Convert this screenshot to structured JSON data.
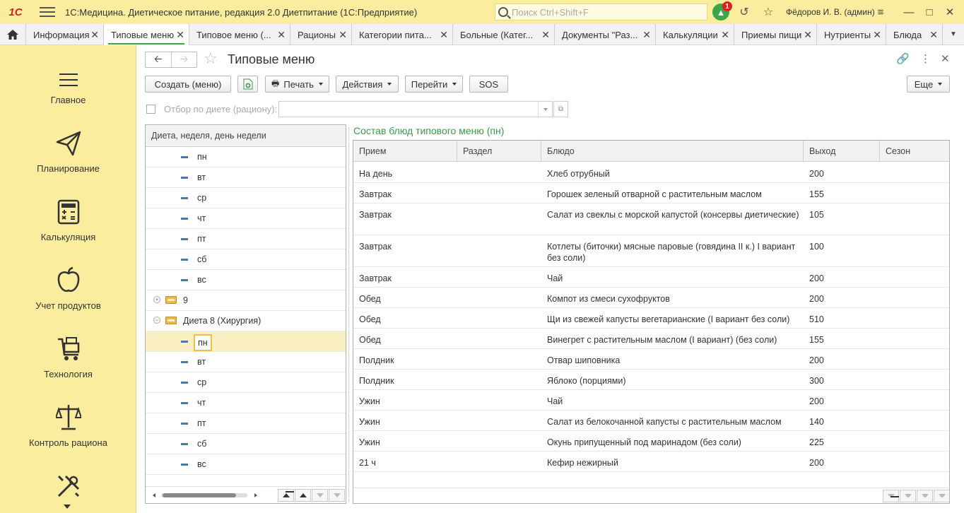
{
  "app": {
    "logo": "1С",
    "title": "1С:Медицина. Диетическое питание, редакция 2.0 Диетпитание  (1С:Предприятие)",
    "search_placeholder": "Поиск Ctrl+Shift+F",
    "notifications": "1",
    "user": "Фёдоров И. В. (админ)"
  },
  "tabs": [
    {
      "label": "Информация"
    },
    {
      "label": "Типовые меню",
      "active": true
    },
    {
      "label": "Типовое меню (..."
    },
    {
      "label": "Рационы"
    },
    {
      "label": "Категории пита..."
    },
    {
      "label": "Больные (Катег..."
    },
    {
      "label": "Документы \"Раз..."
    },
    {
      "label": "Калькуляции"
    },
    {
      "label": "Приемы пищи"
    },
    {
      "label": "Нутриенты"
    },
    {
      "label": "Блюда"
    }
  ],
  "sidebar": {
    "items": [
      {
        "label": "Главное",
        "icon": "menu-lines-icon"
      },
      {
        "label": "Планирование",
        "icon": "paper-plane-icon"
      },
      {
        "label": "Калькуляция",
        "icon": "calculator-icon"
      },
      {
        "label": "Учет продуктов",
        "icon": "apple-icon"
      },
      {
        "label": "Технология",
        "icon": "cart-icon"
      },
      {
        "label": "Контроль рациона",
        "icon": "scales-icon"
      },
      {
        "label": "",
        "icon": "tools-icon"
      }
    ]
  },
  "form": {
    "title": "Типовые меню",
    "buttons": {
      "create": "Создать (меню)",
      "print": "Печать",
      "actions": "Действия",
      "goto": "Перейти",
      "sos": "SOS",
      "more": "Еще"
    },
    "filter": {
      "label": "Отбор по диете (рациону):",
      "value": ""
    }
  },
  "tree": {
    "header": "Диета, неделя, день недели",
    "rows": [
      {
        "type": "day",
        "label": "пн"
      },
      {
        "type": "day",
        "label": "вт"
      },
      {
        "type": "day",
        "label": "ср"
      },
      {
        "type": "day",
        "label": "чт"
      },
      {
        "type": "day",
        "label": "пт"
      },
      {
        "type": "day",
        "label": "сб"
      },
      {
        "type": "day",
        "label": "вс"
      },
      {
        "type": "group",
        "label": "9",
        "expander": "+"
      },
      {
        "type": "group",
        "label": "Диета 8 (Хирургия)",
        "expander": "−"
      },
      {
        "type": "day",
        "label": "пн",
        "selected": true
      },
      {
        "type": "day",
        "label": "вт"
      },
      {
        "type": "day",
        "label": "ср"
      },
      {
        "type": "day",
        "label": "чт"
      },
      {
        "type": "day",
        "label": "пт"
      },
      {
        "type": "day",
        "label": "сб"
      },
      {
        "type": "day",
        "label": "вс"
      }
    ]
  },
  "menu": {
    "title": "Состав блюд типового меню (пн)",
    "columns": [
      "Прием",
      "Раздел",
      "Блюдо",
      "Выход",
      "Сезон"
    ],
    "rows": [
      {
        "meal": "На день",
        "section": "",
        "dish": "Хлеб отрубный",
        "output": "200",
        "season": ""
      },
      {
        "meal": "Завтрак",
        "section": "",
        "dish": "Горошек зеленый отварной с растительным маслом",
        "output": "155",
        "season": ""
      },
      {
        "meal": "Завтрак",
        "section": "",
        "dish": "Салат из свеклы с морской капустой (консервы диетические)",
        "output": "105",
        "season": ""
      },
      {
        "meal": "Завтрак",
        "section": "",
        "dish": "Котлеты (биточки) мясные паровые (говядина II к.) I вариант без соли)",
        "output": "100",
        "season": ""
      },
      {
        "meal": "Завтрак",
        "section": "",
        "dish": "Чай",
        "output": "200",
        "season": ""
      },
      {
        "meal": "Обед",
        "section": "",
        "dish": "Компот из смеси сухофруктов",
        "output": "200",
        "season": ""
      },
      {
        "meal": "Обед",
        "section": "",
        "dish": "Щи из свежей капусты вегетарианские (I вариант без соли)",
        "output": "510",
        "season": ""
      },
      {
        "meal": "Обед",
        "section": "",
        "dish": "Винегрет с растительным маслом (I вариант) (без соли)",
        "output": "155",
        "season": ""
      },
      {
        "meal": "Полдник",
        "section": "",
        "dish": "Отвар шиповника",
        "output": "200",
        "season": ""
      },
      {
        "meal": "Полдник",
        "section": "",
        "dish": "Яблоко (порциями)",
        "output": "300",
        "season": ""
      },
      {
        "meal": "Ужин",
        "section": "",
        "dish": "Чай",
        "output": "200",
        "season": ""
      },
      {
        "meal": "Ужин",
        "section": "",
        "dish": "Салат из белокочанной капусты с растительным маслом",
        "output": "140",
        "season": ""
      },
      {
        "meal": "Ужин",
        "section": "",
        "dish": "Окунь припущенный под маринадом (без соли)",
        "output": "225",
        "season": ""
      },
      {
        "meal": "21 ч",
        "section": "",
        "dish": "Кефир нежирный",
        "output": "200",
        "season": ""
      }
    ]
  }
}
